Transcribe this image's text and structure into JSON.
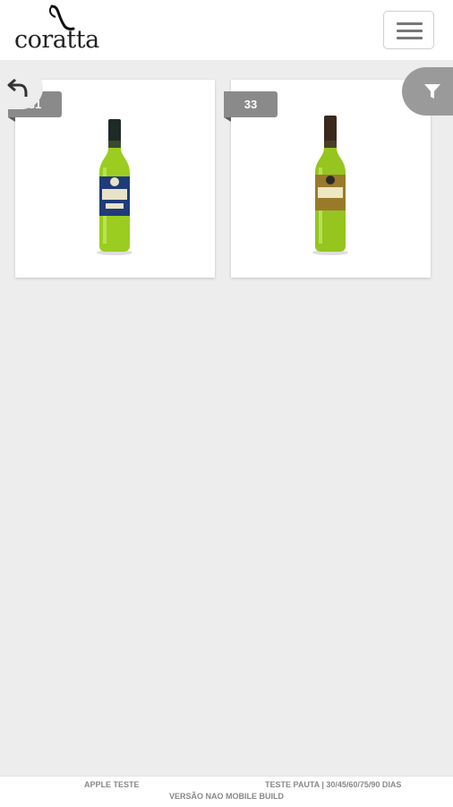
{
  "header": {
    "logo_text": "coratta"
  },
  "products": [
    {
      "tag": "31",
      "label_color": "#1f3b7a"
    },
    {
      "tag": "33",
      "label_color": "#9a7a2a"
    }
  ],
  "footer": {
    "left": "APPLE TESTE",
    "right": "TESTE PAUTA | 30/45/60/75/90 DIAS",
    "center": "VERSÃO NAO MOBILE BUILD"
  },
  "colors": {
    "background": "#ededed",
    "tag": "#8a8a8a",
    "bottle_glass": "#9acd1f"
  },
  "icons": [
    "back-arrow-icon",
    "filter-icon",
    "hamburger-menu-icon"
  ]
}
